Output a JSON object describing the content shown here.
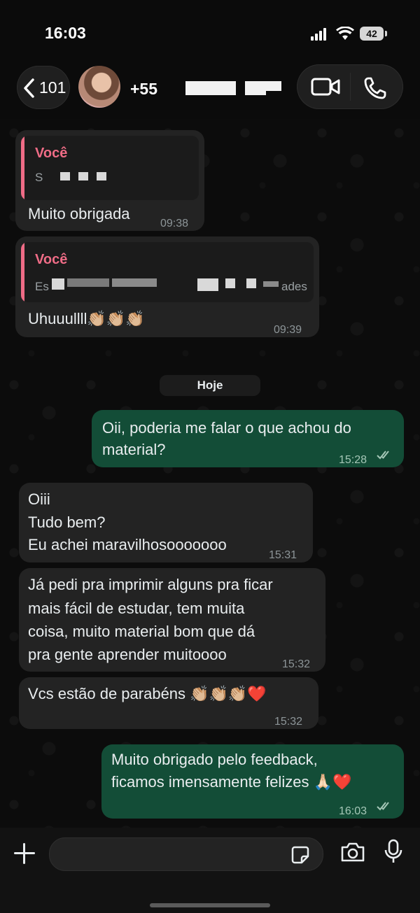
{
  "status_bar": {
    "time": "16:03",
    "battery": "42"
  },
  "header": {
    "back_count": "101",
    "contact_name": "+55"
  },
  "messages": [
    {
      "quote_name": "Você",
      "quote_text": "S",
      "text": "Muito obrigada",
      "time": "09:38"
    },
    {
      "quote_name": "Você",
      "quote_text": "Es",
      "quote_tail": "ades",
      "text": "Uhuuullll👏🏼👏🏼👏🏼",
      "time": "09:39"
    },
    {
      "date_chip": "Hoje"
    },
    {
      "lines": [
        "Oii, poderia me falar o que achou do",
        "material?"
      ],
      "time": "15:28"
    },
    {
      "lines": [
        "Oiii",
        "Tudo bem?",
        "Eu achei maravilhosooooooo"
      ],
      "time": "15:31"
    },
    {
      "lines": [
        "Já pedi pra imprimir alguns pra ficar",
        "mais fácil de estudar, tem muita",
        "coisa, muito material bom que dá",
        "pra gente aprender muitoooo"
      ],
      "time": "15:32"
    },
    {
      "text": "Vcs estão de parabéns 👏🏼👏🏼👏🏼❤️",
      "time": "15:32"
    },
    {
      "lines": [
        "Muito obrigado pelo feedback,",
        "ficamos imensamente felizes 🙏🏻❤️"
      ],
      "time": "16:03"
    }
  ],
  "composer": {
    "placeholder": ""
  },
  "colors": {
    "outgoing": "#134d37",
    "incoming": "#232323",
    "quote_accent": "#ef6c86"
  }
}
